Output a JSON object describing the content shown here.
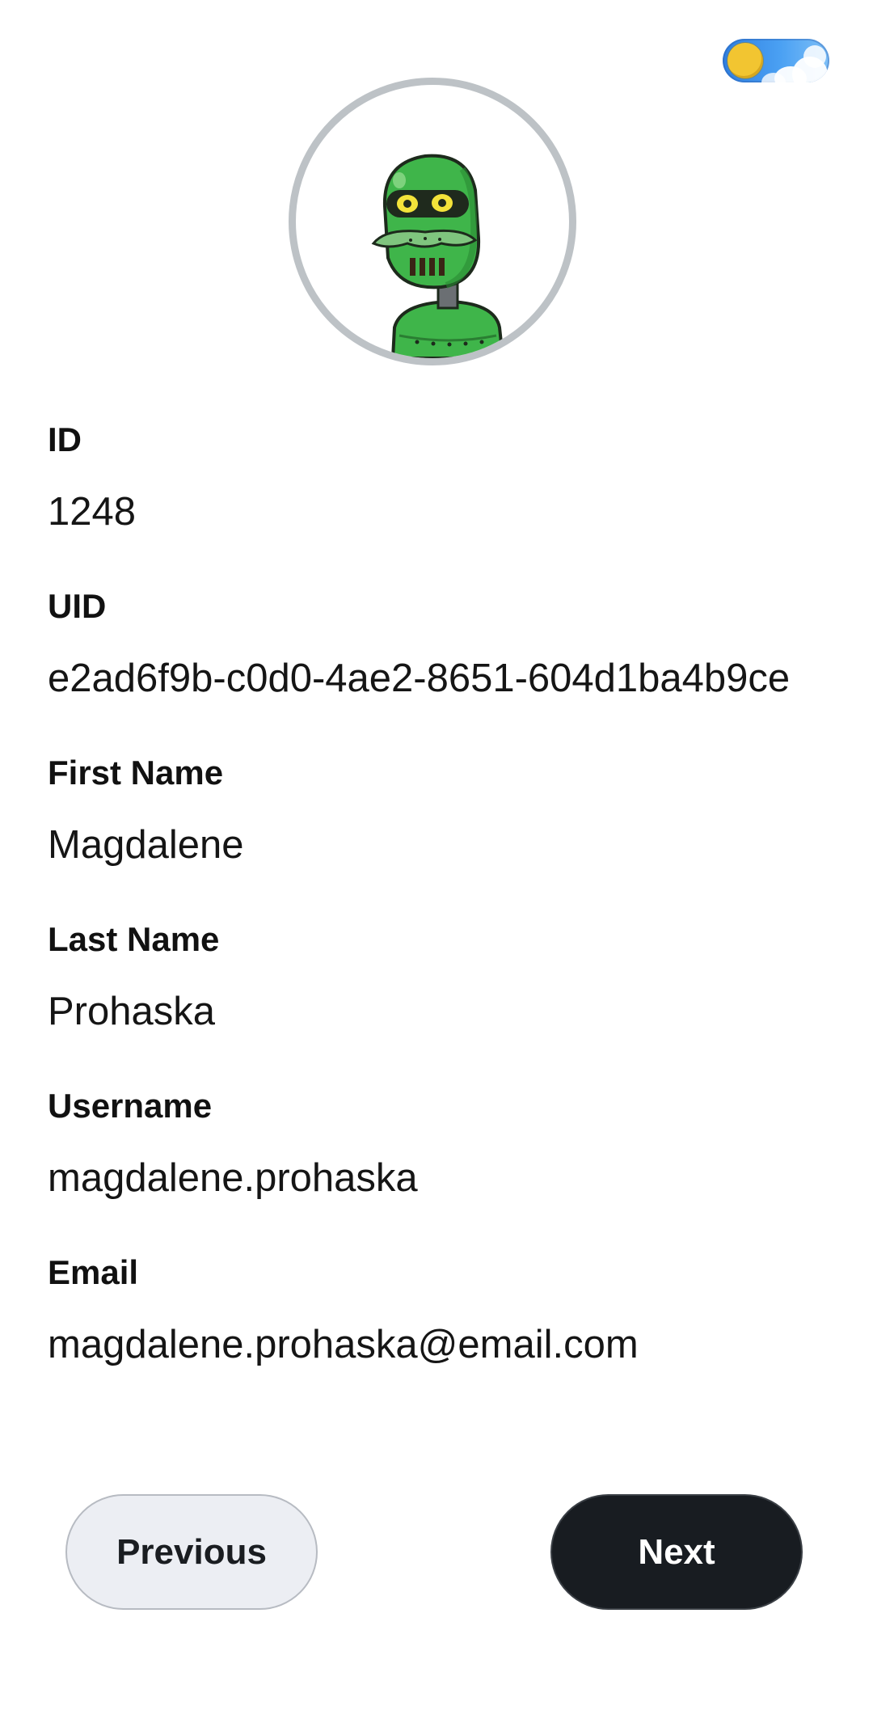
{
  "theme_toggle": {
    "state": "light",
    "icon": "sun-icon"
  },
  "avatar": {
    "icon": "robot-avatar",
    "colors": {
      "ring": "#bdc2c6",
      "robot": "#3fb54a"
    }
  },
  "fields": [
    {
      "label": "ID",
      "value": "1248"
    },
    {
      "label": "UID",
      "value": "e2ad6f9b-c0d0-4ae2-8651-604d1ba4b9ce"
    },
    {
      "label": "First Name",
      "value": "Magdalene"
    },
    {
      "label": "Last Name",
      "value": "Prohaska"
    },
    {
      "label": "Username",
      "value": "magdalene.prohaska"
    },
    {
      "label": "Email",
      "value": "magdalene.prohaska@email.com"
    }
  ],
  "buttons": {
    "previous_label": "Previous",
    "next_label": "Next"
  },
  "colors": {
    "primary_button": "#181c21",
    "secondary_button": "#eceef3"
  }
}
